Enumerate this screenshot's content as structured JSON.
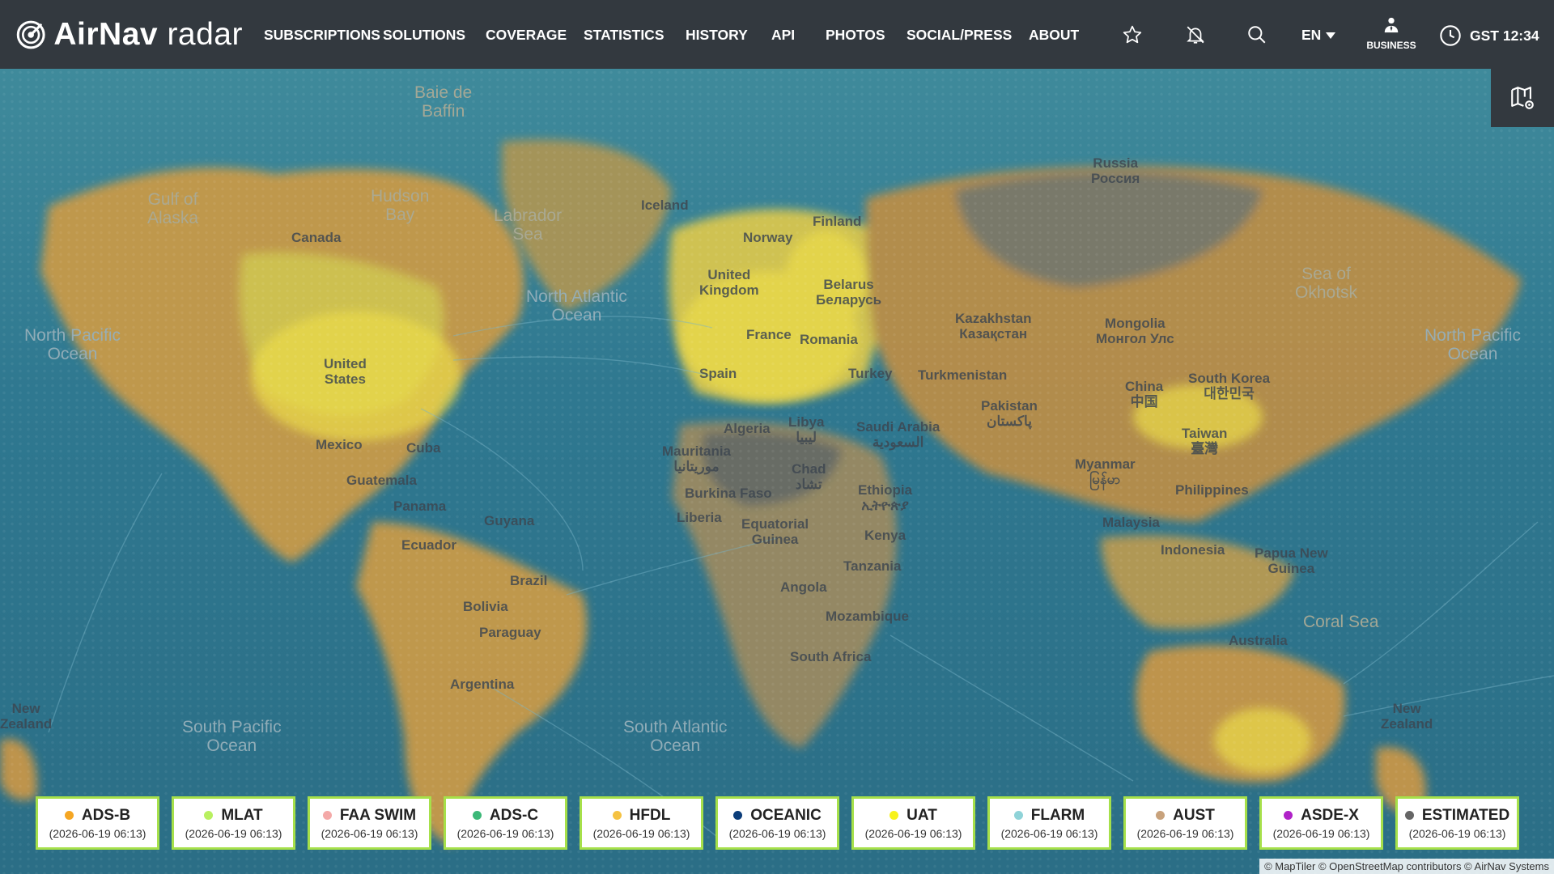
{
  "app": {
    "brand_bold": "AirNav",
    "brand_light": " radar"
  },
  "nav": {
    "items": [
      "SUBSCRIPTIONS",
      "SOLUTIONS",
      "COVERAGE",
      "STATISTICS",
      "HISTORY",
      "API",
      "PHOTOS",
      "SOCIAL/PRESS",
      "ABOUT"
    ],
    "language": "EN",
    "business_label": "BUSINESS",
    "clock": "GST 12:34"
  },
  "map": {
    "oceans": [
      {
        "text": "North Pacific\nOcean"
      },
      {
        "text": "North Atlantic\nOcean"
      },
      {
        "text": "South Pacific\nOcean"
      },
      {
        "text": "South Atlantic\nOcean"
      },
      {
        "text": "North Pacific\nOcean"
      }
    ],
    "seas": [
      {
        "text": "Baie de\nBaffin"
      },
      {
        "text": "Gulf of\nAlaska"
      },
      {
        "text": "Hudson\nBay"
      },
      {
        "text": "Labrador\nSea"
      },
      {
        "text": "Sea of\nOkhotsk"
      },
      {
        "text": "Coral Sea"
      }
    ],
    "countries": [
      "Canada",
      "United\nStates",
      "Mexico",
      "Cuba",
      "Guatemala",
      "Panama",
      "Ecuador",
      "Guyana",
      "Brazil",
      "Bolivia",
      "Paraguay",
      "Argentina",
      "Iceland",
      "Norway",
      "Finland",
      "United\nKingdom",
      "France",
      "Spain",
      "Belarus\nБеларусь",
      "Romania",
      "Turkey",
      "Algeria",
      "Libya\nليبيا",
      "Mauritania\nموريتانيا",
      "Chad\nتشاد",
      "Burkina Faso",
      "Liberia",
      "Equatorial\nGuinea",
      "Ethiopia\nኢትዮጵያ",
      "Kenya",
      "Tanzania",
      "Angola",
      "Mozambique",
      "South Africa",
      "Russia\nРоссия",
      "Kazakhstan\nКазақстан",
      "Mongolia\nМонгол Улс",
      "Turkmenistan",
      "Saudi Arabia\nالسعودية",
      "Pakistan\nپاکستان",
      "China\n中国",
      "South Korea\n대한민국",
      "Taiwan\n臺灣",
      "Myanmar\nမြန်မာ",
      "Philippines",
      "Malaysia",
      "Indonesia",
      "Papua New\nGuinea",
      "Australia",
      "New\nZealand",
      "New\nZealand"
    ]
  },
  "legend": [
    {
      "label": "ADS-B",
      "date": "(2026-06-19 06:13)",
      "color": "#f5a623"
    },
    {
      "label": "MLAT",
      "date": "(2026-06-19 06:13)",
      "color": "#b8f060"
    },
    {
      "label": "FAA SWIM",
      "date": "(2026-06-19 06:13)",
      "color": "#f4a9a8"
    },
    {
      "label": "ADS-C",
      "date": "(2026-06-19 06:13)",
      "color": "#3cb878"
    },
    {
      "label": "HFDL",
      "date": "(2026-06-19 06:13)",
      "color": "#f5c242"
    },
    {
      "label": "OCEANIC",
      "date": "(2026-06-19 06:13)",
      "color": "#0b3d7a"
    },
    {
      "label": "UAT",
      "date": "(2026-06-19 06:13)",
      "color": "#f7f21c"
    },
    {
      "label": "FLARM",
      "date": "(2026-06-19 06:13)",
      "color": "#8fd3d8"
    },
    {
      "label": "AUST",
      "date": "(2026-06-19 06:13)",
      "color": "#c8a27c"
    },
    {
      "label": "ASDE-X",
      "date": "(2026-06-19 06:13)",
      "color": "#b022c8"
    },
    {
      "label": "ESTIMATED",
      "date": "(2026-06-19 06:13)",
      "color": "#666666"
    }
  ],
  "attribution": "© MapTiler © OpenStreetMap contributors © AirNav Systems"
}
